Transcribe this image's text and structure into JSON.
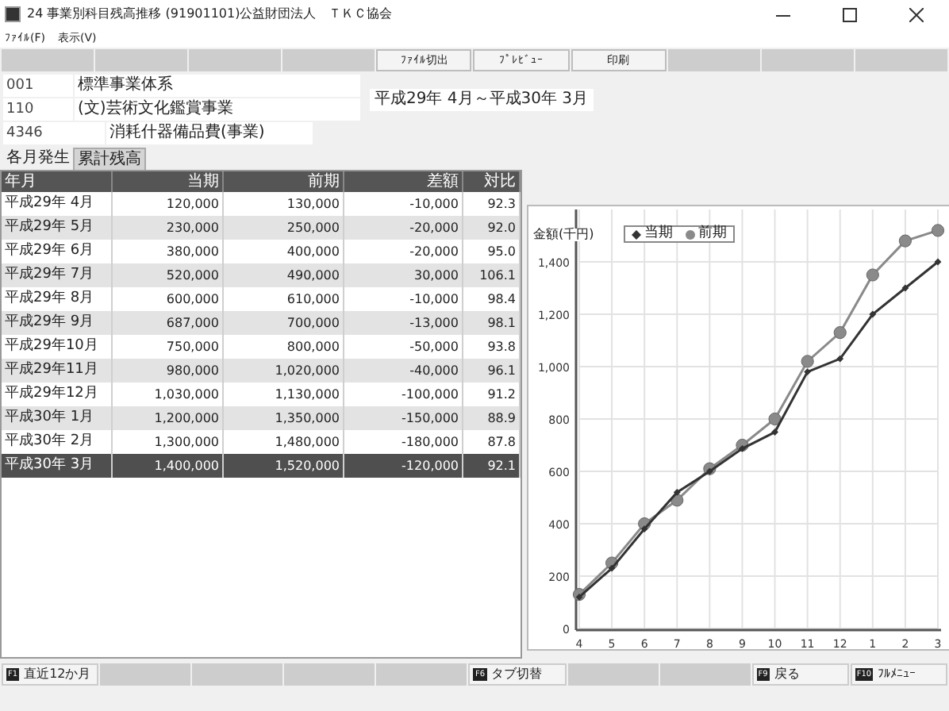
{
  "window": {
    "title": "24 事業別科目残高推移 (91901101)公益財団法人　ＴＫＣ協会"
  },
  "menu": [
    "ﾌｧｲﾙ(F)",
    "表示(V)"
  ],
  "toolbar": [
    {
      "kind": "empty"
    },
    {
      "kind": "empty"
    },
    {
      "kind": "empty"
    },
    {
      "kind": "empty"
    },
    {
      "kind": "button",
      "label": "ﾌｧｲﾙ切出"
    },
    {
      "kind": "button",
      "label": "ﾌﾟﾚﾋﾞｭｰ"
    },
    {
      "kind": "button",
      "label": "印刷"
    },
    {
      "kind": "empty"
    },
    {
      "kind": "empty"
    },
    {
      "kind": "empty"
    }
  ],
  "fields": [
    {
      "code": "001",
      "name": "標準事業体系"
    },
    {
      "code": "110",
      "name": "(文)芸術文化鑑賞事業"
    },
    {
      "code": "4346",
      "name": "消耗什器備品費(事業)"
    }
  ],
  "period": "平成29年 4月～平成30年 3月",
  "tabs": [
    {
      "label": "各月発生",
      "selected": false
    },
    {
      "label": "累計残高",
      "selected": true
    }
  ],
  "table": {
    "columns": [
      "年月",
      "当期",
      "前期",
      "差額",
      "対比"
    ],
    "rows": [
      {
        "cells": [
          "平成29年 4月",
          "120,000",
          "130,000",
          "-10,000",
          "92.3"
        ],
        "selected": false
      },
      {
        "cells": [
          "平成29年 5月",
          "230,000",
          "250,000",
          "-20,000",
          "92.0"
        ],
        "selected": false
      },
      {
        "cells": [
          "平成29年 6月",
          "380,000",
          "400,000",
          "-20,000",
          "95.0"
        ],
        "selected": false
      },
      {
        "cells": [
          "平成29年 7月",
          "520,000",
          "490,000",
          "30,000",
          "106.1"
        ],
        "selected": false
      },
      {
        "cells": [
          "平成29年 8月",
          "600,000",
          "610,000",
          "-10,000",
          "98.4"
        ],
        "selected": false
      },
      {
        "cells": [
          "平成29年 9月",
          "687,000",
          "700,000",
          "-13,000",
          "98.1"
        ],
        "selected": false
      },
      {
        "cells": [
          "平成29年10月",
          "750,000",
          "800,000",
          "-50,000",
          "93.8"
        ],
        "selected": false
      },
      {
        "cells": [
          "平成29年11月",
          "980,000",
          "1,020,000",
          "-40,000",
          "96.1"
        ],
        "selected": false
      },
      {
        "cells": [
          "平成29年12月",
          "1,030,000",
          "1,130,000",
          "-100,000",
          "91.2"
        ],
        "selected": false
      },
      {
        "cells": [
          "平成30年 1月",
          "1,200,000",
          "1,350,000",
          "-150,000",
          "88.9"
        ],
        "selected": false
      },
      {
        "cells": [
          "平成30年 2月",
          "1,300,000",
          "1,480,000",
          "-180,000",
          "87.8"
        ],
        "selected": false
      },
      {
        "cells": [
          "平成30年 3月",
          "1,400,000",
          "1,520,000",
          "-120,000",
          "92.1"
        ],
        "selected": true
      }
    ]
  },
  "chart": {
    "chart_data": {
      "type": "line",
      "ylabel": "金額(千円)",
      "categories": [
        "4",
        "5",
        "6",
        "7",
        "8",
        "9",
        "10",
        "11",
        "12",
        "1",
        "2",
        "3"
      ],
      "series": [
        {
          "name": "当期",
          "color": "#333333",
          "marker": "diamond",
          "values": [
            120,
            230,
            380,
            520,
            600,
            687,
            750,
            980,
            1030,
            1200,
            1300,
            1400
          ]
        },
        {
          "name": "前期",
          "color": "#8a8a8a",
          "marker": "circle",
          "values": [
            130,
            250,
            400,
            490,
            610,
            700,
            800,
            1020,
            1130,
            1350,
            1480,
            1520
          ]
        }
      ],
      "ylim": [
        0,
        1600
      ],
      "grid": true,
      "legend": true,
      "yticks": [
        {
          "value": 0,
          "label": "0"
        },
        {
          "value": 200,
          "label": "200"
        },
        {
          "value": 400,
          "label": "400"
        },
        {
          "value": 600,
          "label": "600"
        },
        {
          "value": 800,
          "label": "800"
        },
        {
          "value": 1000,
          "label": "1,000"
        },
        {
          "value": 1200,
          "label": "1,200"
        },
        {
          "value": 1400,
          "label": "1,400"
        }
      ]
    }
  },
  "function_keys": [
    {
      "kind": "key",
      "key": "F1",
      "label": "直近12か月"
    },
    {
      "kind": "empty"
    },
    {
      "kind": "empty"
    },
    {
      "kind": "empty"
    },
    {
      "kind": "empty"
    },
    {
      "kind": "key",
      "key": "F6",
      "label": "タブ切替"
    },
    {
      "kind": "empty"
    },
    {
      "kind": "empty"
    },
    {
      "kind": "key",
      "key": "F9",
      "label": "戻る"
    },
    {
      "kind": "key",
      "key": "F10",
      "label": "ﾌﾙﾒﾆｭｰ"
    }
  ]
}
